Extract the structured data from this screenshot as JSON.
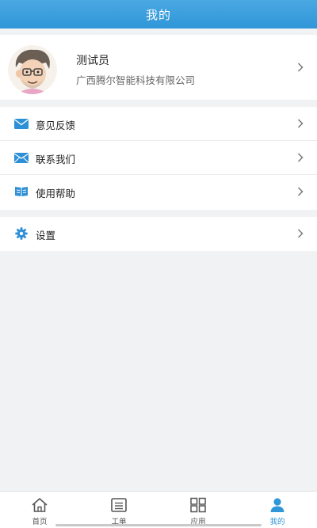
{
  "header": {
    "title": "我的"
  },
  "profile": {
    "name": "测试员",
    "company": "广西腾尔智能科技有限公司"
  },
  "menu": {
    "items": [
      {
        "label": "意见反馈",
        "icon": "mail-icon"
      },
      {
        "label": "联系我们",
        "icon": "envelope-icon"
      },
      {
        "label": "使用帮助",
        "icon": "book-icon"
      }
    ]
  },
  "settings": {
    "label": "设置",
    "icon": "gear-icon"
  },
  "tabbar": {
    "items": [
      {
        "label": "首页",
        "icon": "home-icon"
      },
      {
        "label": "工单",
        "icon": "list-icon"
      },
      {
        "label": "应用",
        "icon": "grid-icon"
      },
      {
        "label": "我的",
        "icon": "person-icon",
        "active": true
      }
    ]
  },
  "colors": {
    "accent": "#2f96d8",
    "icon_blue": "#2d8fd5",
    "background": "#f1f2f3"
  }
}
